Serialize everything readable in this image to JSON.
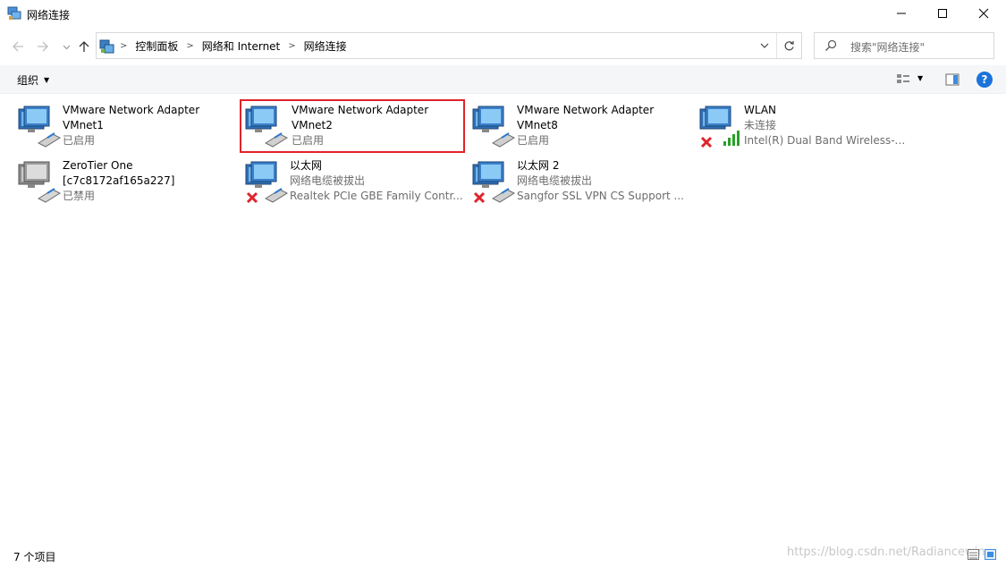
{
  "window": {
    "title": "网络连接",
    "minimize_icon": "minimize-icon",
    "maximize_icon": "maximize-icon",
    "close_icon": "close-icon"
  },
  "address": {
    "crumbs": [
      "控制面板",
      "网络和 Internet",
      "网络连接"
    ],
    "search_placeholder": "搜索\"网络连接\""
  },
  "toolbar": {
    "organize_label": "组织"
  },
  "adapters": [
    {
      "name": "VMware Network Adapter",
      "line2": "VMnet1",
      "status": "已启用",
      "icon": "network-adapter-enabled-icon",
      "state": "enabled"
    },
    {
      "name": "VMware Network Adapter",
      "line2": "VMnet2",
      "status": "已启用",
      "icon": "network-adapter-enabled-icon",
      "state": "enabled",
      "selected": true
    },
    {
      "name": "VMware Network Adapter",
      "line2": "VMnet8",
      "status": "已启用",
      "icon": "network-adapter-enabled-icon",
      "state": "enabled"
    },
    {
      "name": "WLAN",
      "line2": "未连接",
      "status": "Intel(R) Dual Band Wireless-A...",
      "icon": "wireless-adapter-disconnected-icon",
      "state": "wifi-disconnected"
    },
    {
      "name": "ZeroTier One",
      "line2": "[c7c8172af165a227]",
      "status": "已禁用",
      "icon": "network-adapter-disabled-icon",
      "state": "disabled"
    },
    {
      "name": "以太网",
      "line2": "网络电缆被拔出",
      "status": "Realtek PCIe GBE Family Contr...",
      "icon": "network-adapter-unplugged-icon",
      "state": "unplugged"
    },
    {
      "name": "以太网 2",
      "line2": "网络电缆被拔出",
      "status": "Sangfor SSL VPN CS Support ...",
      "icon": "network-adapter-unplugged-icon",
      "state": "unplugged"
    }
  ],
  "status": {
    "count": "7 个项目"
  },
  "watermark": "https://blog.csdn.net/Radiancewin",
  "colors": {
    "selection_border": "#e0232a",
    "help_blue": "#1a73d9",
    "error_red": "#e0232a",
    "signal_green": "#2aa02a"
  }
}
